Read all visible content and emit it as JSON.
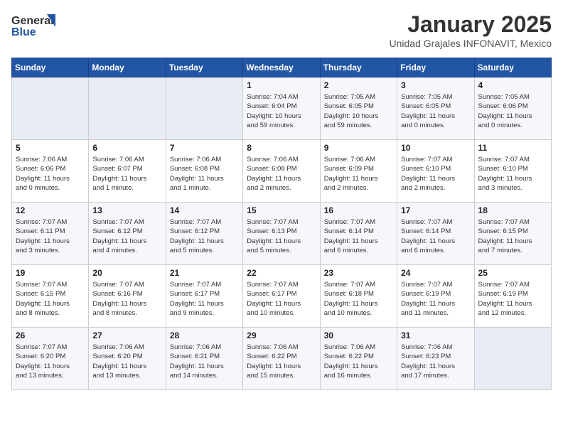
{
  "header": {
    "logo_line1": "General",
    "logo_line2": "Blue",
    "title": "January 2025",
    "subtitle": "Unidad Grajales INFONAVIT, Mexico"
  },
  "weekdays": [
    "Sunday",
    "Monday",
    "Tuesday",
    "Wednesday",
    "Thursday",
    "Friday",
    "Saturday"
  ],
  "weeks": [
    [
      {
        "day": "",
        "info": ""
      },
      {
        "day": "",
        "info": ""
      },
      {
        "day": "",
        "info": ""
      },
      {
        "day": "1",
        "info": "Sunrise: 7:04 AM\nSunset: 6:04 PM\nDaylight: 10 hours\nand 59 minutes."
      },
      {
        "day": "2",
        "info": "Sunrise: 7:05 AM\nSunset: 6:05 PM\nDaylight: 10 hours\nand 59 minutes."
      },
      {
        "day": "3",
        "info": "Sunrise: 7:05 AM\nSunset: 6:05 PM\nDaylight: 11 hours\nand 0 minutes."
      },
      {
        "day": "4",
        "info": "Sunrise: 7:05 AM\nSunset: 6:06 PM\nDaylight: 11 hours\nand 0 minutes."
      }
    ],
    [
      {
        "day": "5",
        "info": "Sunrise: 7:06 AM\nSunset: 6:06 PM\nDaylight: 11 hours\nand 0 minutes."
      },
      {
        "day": "6",
        "info": "Sunrise: 7:06 AM\nSunset: 6:07 PM\nDaylight: 11 hours\nand 1 minute."
      },
      {
        "day": "7",
        "info": "Sunrise: 7:06 AM\nSunset: 6:08 PM\nDaylight: 11 hours\nand 1 minute."
      },
      {
        "day": "8",
        "info": "Sunrise: 7:06 AM\nSunset: 6:08 PM\nDaylight: 11 hours\nand 2 minutes."
      },
      {
        "day": "9",
        "info": "Sunrise: 7:06 AM\nSunset: 6:09 PM\nDaylight: 11 hours\nand 2 minutes."
      },
      {
        "day": "10",
        "info": "Sunrise: 7:07 AM\nSunset: 6:10 PM\nDaylight: 11 hours\nand 2 minutes."
      },
      {
        "day": "11",
        "info": "Sunrise: 7:07 AM\nSunset: 6:10 PM\nDaylight: 11 hours\nand 3 minutes."
      }
    ],
    [
      {
        "day": "12",
        "info": "Sunrise: 7:07 AM\nSunset: 6:11 PM\nDaylight: 11 hours\nand 3 minutes."
      },
      {
        "day": "13",
        "info": "Sunrise: 7:07 AM\nSunset: 6:12 PM\nDaylight: 11 hours\nand 4 minutes."
      },
      {
        "day": "14",
        "info": "Sunrise: 7:07 AM\nSunset: 6:12 PM\nDaylight: 11 hours\nand 5 minutes."
      },
      {
        "day": "15",
        "info": "Sunrise: 7:07 AM\nSunset: 6:13 PM\nDaylight: 11 hours\nand 5 minutes."
      },
      {
        "day": "16",
        "info": "Sunrise: 7:07 AM\nSunset: 6:14 PM\nDaylight: 11 hours\nand 6 minutes."
      },
      {
        "day": "17",
        "info": "Sunrise: 7:07 AM\nSunset: 6:14 PM\nDaylight: 11 hours\nand 6 minutes."
      },
      {
        "day": "18",
        "info": "Sunrise: 7:07 AM\nSunset: 6:15 PM\nDaylight: 11 hours\nand 7 minutes."
      }
    ],
    [
      {
        "day": "19",
        "info": "Sunrise: 7:07 AM\nSunset: 6:15 PM\nDaylight: 11 hours\nand 8 minutes."
      },
      {
        "day": "20",
        "info": "Sunrise: 7:07 AM\nSunset: 6:16 PM\nDaylight: 11 hours\nand 8 minutes."
      },
      {
        "day": "21",
        "info": "Sunrise: 7:07 AM\nSunset: 6:17 PM\nDaylight: 11 hours\nand 9 minutes."
      },
      {
        "day": "22",
        "info": "Sunrise: 7:07 AM\nSunset: 6:17 PM\nDaylight: 11 hours\nand 10 minutes."
      },
      {
        "day": "23",
        "info": "Sunrise: 7:07 AM\nSunset: 6:18 PM\nDaylight: 11 hours\nand 10 minutes."
      },
      {
        "day": "24",
        "info": "Sunrise: 7:07 AM\nSunset: 6:19 PM\nDaylight: 11 hours\nand 11 minutes."
      },
      {
        "day": "25",
        "info": "Sunrise: 7:07 AM\nSunset: 6:19 PM\nDaylight: 11 hours\nand 12 minutes."
      }
    ],
    [
      {
        "day": "26",
        "info": "Sunrise: 7:07 AM\nSunset: 6:20 PM\nDaylight: 11 hours\nand 13 minutes."
      },
      {
        "day": "27",
        "info": "Sunrise: 7:06 AM\nSunset: 6:20 PM\nDaylight: 11 hours\nand 13 minutes."
      },
      {
        "day": "28",
        "info": "Sunrise: 7:06 AM\nSunset: 6:21 PM\nDaylight: 11 hours\nand 14 minutes."
      },
      {
        "day": "29",
        "info": "Sunrise: 7:06 AM\nSunset: 6:22 PM\nDaylight: 11 hours\nand 15 minutes."
      },
      {
        "day": "30",
        "info": "Sunrise: 7:06 AM\nSunset: 6:22 PM\nDaylight: 11 hours\nand 16 minutes."
      },
      {
        "day": "31",
        "info": "Sunrise: 7:06 AM\nSunset: 6:23 PM\nDaylight: 11 hours\nand 17 minutes."
      },
      {
        "day": "",
        "info": ""
      }
    ]
  ]
}
